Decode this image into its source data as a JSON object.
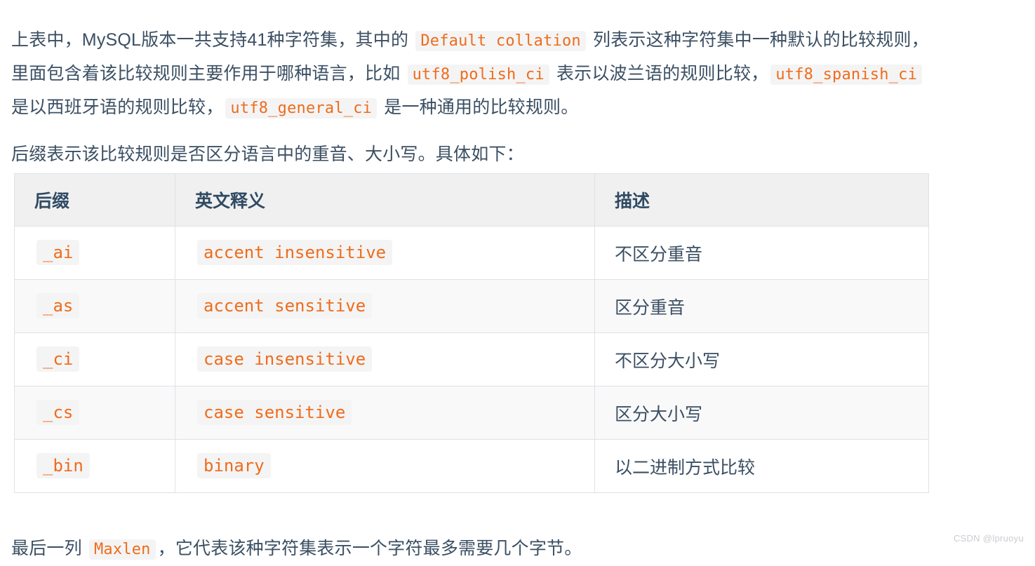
{
  "document": {
    "paragraph_1": {
      "seg_1": "上表中，MySQL版本一共支持41种字符集，其中的 ",
      "code_1": "Default collation",
      "seg_2": " 列表示这种字符集中一种默认的比较规则，里面包含着该比较规则主要作用于哪种语言，比如 ",
      "code_2": "utf8_polish_ci",
      "seg_3": " 表示以波兰语的规则比较，",
      "code_3": "utf8_spanish_ci",
      "seg_4": " 是以西班牙语的规则比较，",
      "code_4": "utf8_general_ci",
      "seg_5": " 是一种通用的比较规则。"
    },
    "paragraph_2": {
      "text": "后缀表示该比较规则是否区分语言中的重音、大小写。具体如下："
    },
    "paragraph_3": {
      "seg_1": "最后一列 ",
      "code_1": "Maxlen",
      "seg_2": "，它代表该种字符集表示一个字符最多需要几个字节。"
    }
  },
  "table": {
    "headers": [
      "后缀",
      "英文释义",
      "描述"
    ],
    "rows": [
      {
        "suffix": "_ai",
        "english": "accent insensitive",
        "description": "不区分重音"
      },
      {
        "suffix": "_as",
        "english": "accent sensitive",
        "description": "区分重音"
      },
      {
        "suffix": "_ci",
        "english": "case insensitive",
        "description": "不区分大小写"
      },
      {
        "suffix": "_cs",
        "english": "case sensitive",
        "description": "区分大小写"
      },
      {
        "suffix": "_bin",
        "english": "binary",
        "description": "以二进制方式比较"
      }
    ]
  },
  "watermark": {
    "text": "CSDN @lpruoyu"
  },
  "colors": {
    "text": "#3b4f63",
    "code_text": "#ef6c1a",
    "code_bg": "#f4f4f5",
    "table_header_bg": "#f0f0f0",
    "table_border": "#dee2e6",
    "row_alt_bg": "#f9f9fa",
    "watermark": "#c9ccd1"
  }
}
